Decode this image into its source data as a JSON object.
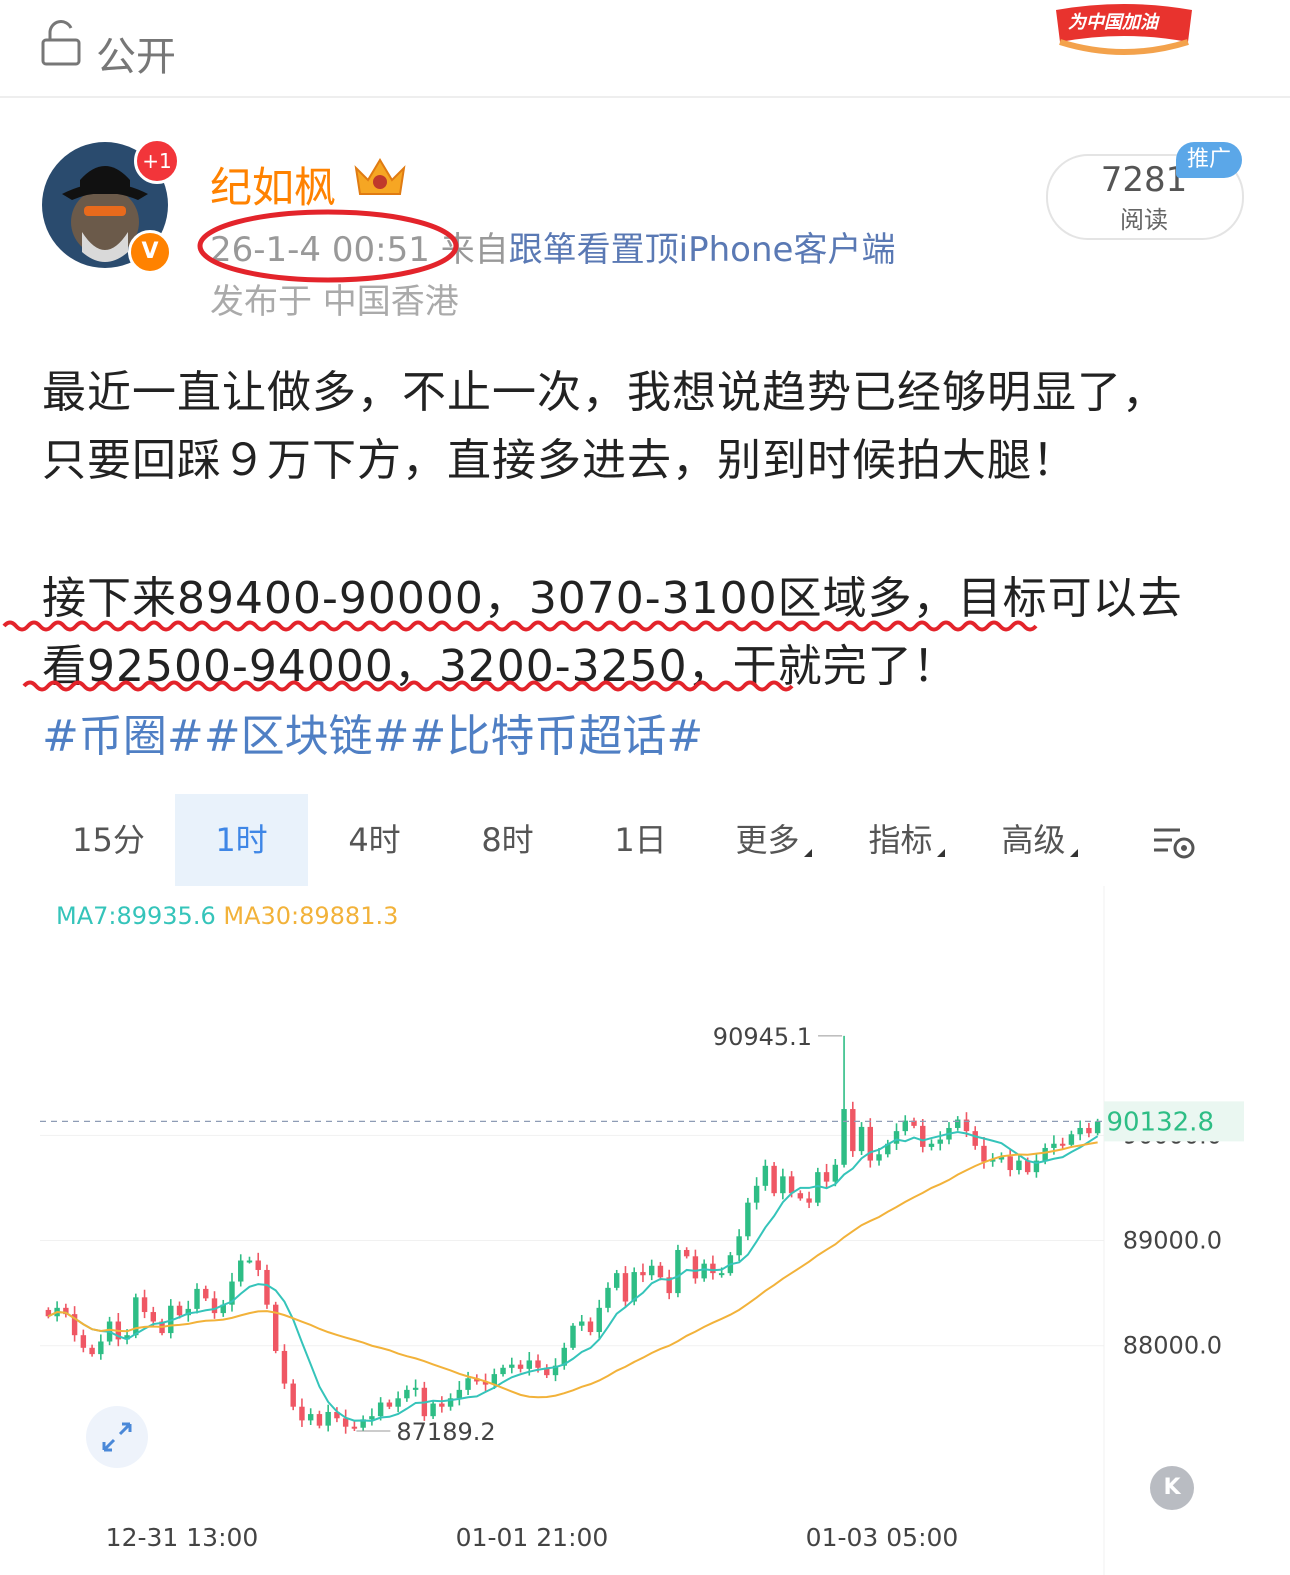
{
  "header": {
    "visibility_label": "公开",
    "cheer_badge_text": "为中国加油"
  },
  "post": {
    "author": "纪如枫",
    "time": "26-1-4 00:51",
    "source_prefix": "来自",
    "source_app": "跟箪看置顶iPhone客户端",
    "location": "发布于 中国香港",
    "read_count": "7281",
    "read_label": "阅读",
    "promo_label": "推广",
    "avatar_badge": "+1",
    "verified_badge": "V",
    "lines": [
      "最近一直让做多，不止一次，我想说趋势已经够明显了，",
      "只要回踩９万下方，直接多进去，别到时候拍大腿！",
      "接下来89400-90000，3070-3100区域多，目标可以去",
      "看92500-94000，3200-3250，干就完了！"
    ],
    "hashtags": "#币圈##区块链##比特币超话#"
  },
  "chart_tabs": [
    {
      "label": "15分",
      "active": false
    },
    {
      "label": "1时",
      "active": true
    },
    {
      "label": "4时",
      "active": false
    },
    {
      "label": "8时",
      "active": false
    },
    {
      "label": "1日",
      "active": false
    },
    {
      "label": "更多",
      "active": false,
      "dropdown": true
    },
    {
      "label": "指标",
      "active": false,
      "dropdown": true
    },
    {
      "label": "高级",
      "active": false,
      "dropdown": true
    }
  ],
  "chart_data": {
    "type": "candlestick",
    "interval": "1时",
    "ma_legend": {
      "ma7": "MA7:89935.6",
      "ma30": "MA30:89881.3"
    },
    "y_ticks": [
      "90000.0",
      "89000.0",
      "88000.0"
    ],
    "y_tick_values": [
      90000,
      89000,
      88000
    ],
    "x_ticks": [
      "12-31 13:00",
      "01-01 21:00",
      "01-03 05:00"
    ],
    "current_price": "90132.8",
    "high_label": "90945.1",
    "low_label": "87189.2",
    "ylim": [
      86400,
      91800
    ],
    "colors": {
      "up": "#2ebd85",
      "down": "#ef5764",
      "ma7": "#35c4ba",
      "ma30": "#f2b23a"
    },
    "closes": [
      88280,
      88360,
      88300,
      88100,
      87980,
      87920,
      88040,
      88230,
      88060,
      88100,
      88460,
      88320,
      88230,
      88120,
      88380,
      88290,
      88350,
      88540,
      88450,
      88310,
      88390,
      88610,
      88810,
      88810,
      88720,
      88390,
      87950,
      87640,
      87420,
      87290,
      87350,
      87240,
      87370,
      87310,
      87230,
      87220,
      87300,
      87330,
      87460,
      87420,
      87500,
      87580,
      87600,
      87330,
      87450,
      87420,
      87500,
      87580,
      87690,
      87660,
      87630,
      87730,
      87790,
      87820,
      87780,
      87860,
      87790,
      87720,
      87810,
      87980,
      88190,
      88230,
      88130,
      88360,
      88550,
      88690,
      88420,
      88700,
      88670,
      88760,
      88650,
      88500,
      88910,
      88850,
      88640,
      88780,
      88690,
      88690,
      88860,
      89040,
      89360,
      89520,
      89710,
      89450,
      89610,
      89450,
      89400,
      89360,
      89650,
      89560,
      89720,
      90250,
      89850,
      90080,
      89760,
      89820,
      89920,
      90040,
      90140,
      90090,
      89890,
      89920,
      89960,
      90070,
      90150,
      90040,
      89900,
      89750,
      89770,
      89800,
      89670,
      89760,
      89650,
      89760,
      89880,
      89920,
      89910,
      90010,
      90070,
      90020,
      90132
    ]
  }
}
